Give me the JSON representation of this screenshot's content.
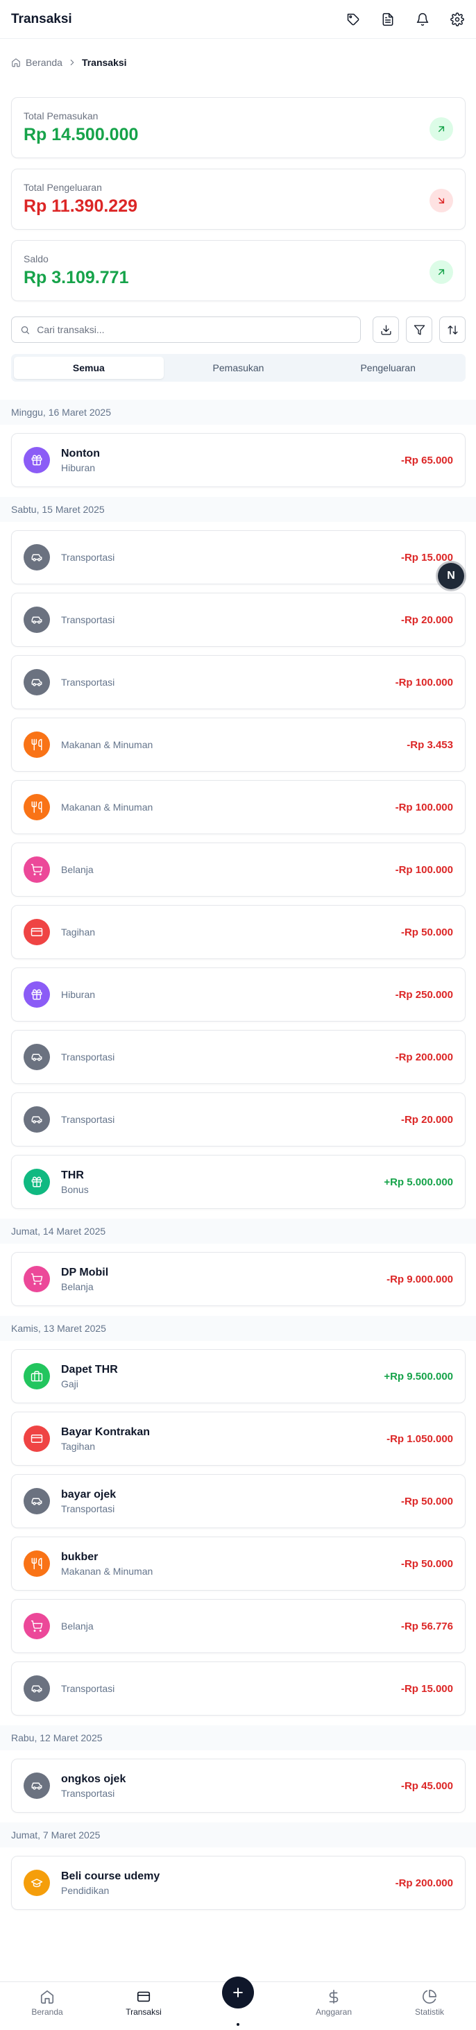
{
  "header": {
    "title": "Transaksi",
    "icons": [
      "tag-icon",
      "file-text-icon",
      "bell-icon",
      "settings-icon"
    ]
  },
  "breadcrumb": {
    "home": "Beranda",
    "current": "Transaksi"
  },
  "summary": [
    {
      "label": "Total Pemasukan",
      "value": "Rp 14.500.000",
      "color": "#16a34a",
      "badge_bg": "#dcfce7",
      "icon": "arrow-up-right-icon"
    },
    {
      "label": "Total Pengeluaran",
      "value": "Rp 11.390.229",
      "color": "#dc2626",
      "badge_bg": "#fee2e2",
      "icon": "arrow-down-right-icon"
    },
    {
      "label": "Saldo",
      "value": "Rp 3.109.771",
      "color": "#16a34a",
      "badge_bg": "#dcfce7",
      "icon": "arrow-up-right-icon"
    }
  ],
  "search": {
    "placeholder": "Cari transaksi...",
    "value": ""
  },
  "tabs": [
    {
      "label": "Semua",
      "active": true
    },
    {
      "label": "Pemasukan",
      "active": false
    },
    {
      "label": "Pengeluaran",
      "active": false
    }
  ],
  "groups": [
    {
      "date": "Minggu, 16 Maret 2025",
      "items": [
        {
          "title": "Nonton",
          "category": "Hiburan",
          "amount": "-Rp 65.000",
          "type": "neg",
          "icon": "gift-icon",
          "color": "#8b5cf6"
        }
      ]
    },
    {
      "date": "Sabtu, 15 Maret 2025",
      "items": [
        {
          "title": "",
          "category": "Transportasi",
          "amount": "-Rp 15.000",
          "type": "neg",
          "icon": "car-icon",
          "color": "#6b7280"
        },
        {
          "title": "",
          "category": "Transportasi",
          "amount": "-Rp 20.000",
          "type": "neg",
          "icon": "car-icon",
          "color": "#6b7280"
        },
        {
          "title": "",
          "category": "Transportasi",
          "amount": "-Rp 100.000",
          "type": "neg",
          "icon": "car-icon",
          "color": "#6b7280"
        },
        {
          "title": "",
          "category": "Makanan & Minuman",
          "amount": "-Rp 3.453",
          "type": "neg",
          "icon": "utensils-icon",
          "color": "#f97316"
        },
        {
          "title": "",
          "category": "Makanan & Minuman",
          "amount": "-Rp 100.000",
          "type": "neg",
          "icon": "utensils-icon",
          "color": "#f97316"
        },
        {
          "title": "",
          "category": "Belanja",
          "amount": "-Rp 100.000",
          "type": "neg",
          "icon": "shopping-cart-icon",
          "color": "#ec4899"
        },
        {
          "title": "",
          "category": "Tagihan",
          "amount": "-Rp 50.000",
          "type": "neg",
          "icon": "credit-card-icon",
          "color": "#ef4444"
        },
        {
          "title": "",
          "category": "Hiburan",
          "amount": "-Rp 250.000",
          "type": "neg",
          "icon": "gift-icon",
          "color": "#8b5cf6"
        },
        {
          "title": "",
          "category": "Transportasi",
          "amount": "-Rp 200.000",
          "type": "neg",
          "icon": "car-icon",
          "color": "#6b7280"
        },
        {
          "title": "",
          "category": "Transportasi",
          "amount": "-Rp 20.000",
          "type": "neg",
          "icon": "car-icon",
          "color": "#6b7280"
        },
        {
          "title": "THR",
          "category": "Bonus",
          "amount": "+Rp 5.000.000",
          "type": "pos",
          "icon": "gift-icon",
          "color": "#10b981"
        }
      ]
    },
    {
      "date": "Jumat, 14 Maret 2025",
      "items": [
        {
          "title": "DP Mobil",
          "category": "Belanja",
          "amount": "-Rp 9.000.000",
          "type": "neg",
          "icon": "shopping-cart-icon",
          "color": "#ec4899"
        }
      ]
    },
    {
      "date": "Kamis, 13 Maret 2025",
      "items": [
        {
          "title": "Dapet THR",
          "category": "Gaji",
          "amount": "+Rp 9.500.000",
          "type": "pos",
          "icon": "briefcase-icon",
          "color": "#22c55e"
        },
        {
          "title": "Bayar Kontrakan",
          "category": "Tagihan",
          "amount": "-Rp 1.050.000",
          "type": "neg",
          "icon": "credit-card-icon",
          "color": "#ef4444"
        },
        {
          "title": "bayar ojek",
          "category": "Transportasi",
          "amount": "-Rp 50.000",
          "type": "neg",
          "icon": "car-icon",
          "color": "#6b7280"
        },
        {
          "title": "bukber",
          "category": "Makanan & Minuman",
          "amount": "-Rp 50.000",
          "type": "neg",
          "icon": "utensils-icon",
          "color": "#f97316"
        },
        {
          "title": "",
          "category": "Belanja",
          "amount": "-Rp 56.776",
          "type": "neg",
          "icon": "shopping-cart-icon",
          "color": "#ec4899"
        },
        {
          "title": "",
          "category": "Transportasi",
          "amount": "-Rp 15.000",
          "type": "neg",
          "icon": "car-icon",
          "color": "#6b7280"
        }
      ]
    },
    {
      "date": "Rabu, 12 Maret 2025",
      "items": [
        {
          "title": "ongkos ojek",
          "category": "Transportasi",
          "amount": "-Rp 45.000",
          "type": "neg",
          "icon": "car-icon",
          "color": "#6b7280"
        }
      ]
    },
    {
      "date": "Jumat, 7 Maret 2025",
      "items": [
        {
          "title": "Beli course udemy",
          "category": "Pendidikan",
          "amount": "-Rp 200.000",
          "type": "neg",
          "icon": "graduation-cap-icon",
          "color": "#f59e0b"
        }
      ]
    }
  ],
  "floating_badge": "N",
  "bottom_nav": [
    {
      "label": "Beranda",
      "icon": "home-icon",
      "active": false
    },
    {
      "label": "Transaksi",
      "icon": "wallet-icon",
      "active": true
    },
    {
      "label": "Anggaran",
      "icon": "dollar-icon",
      "active": false
    },
    {
      "label": "Statistik",
      "icon": "pie-chart-icon",
      "active": false
    }
  ],
  "fab_icon": "plus-icon"
}
